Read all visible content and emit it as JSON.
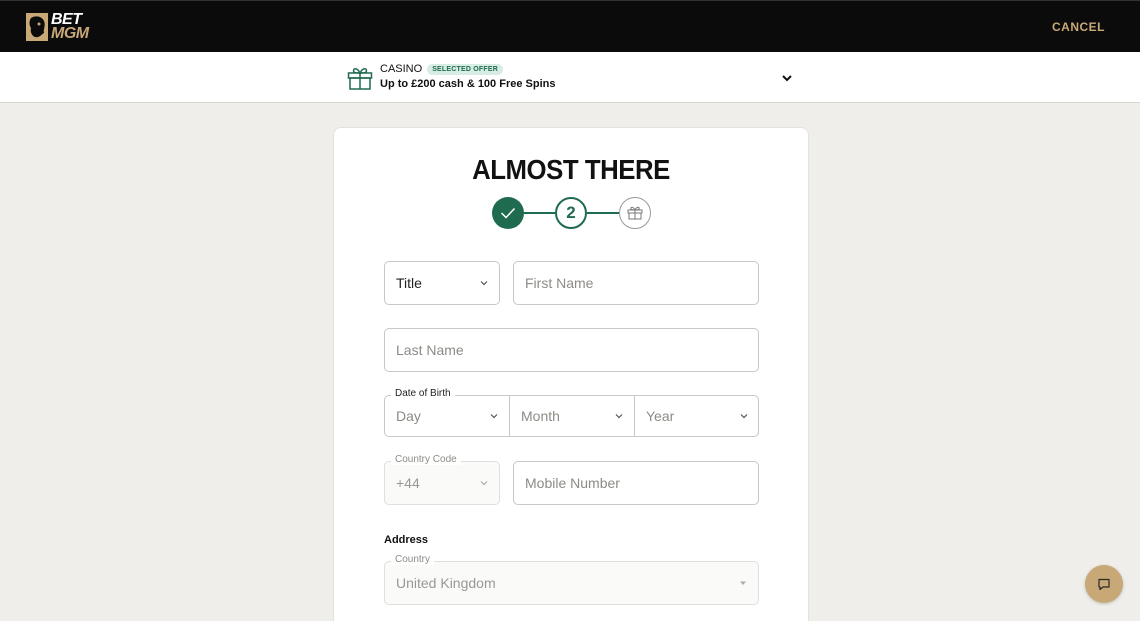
{
  "header": {
    "logo_top": "BET",
    "logo_bottom": "MGM",
    "cancel_label": "CANCEL"
  },
  "offer": {
    "category": "CASINO",
    "badge": "SELECTED OFFER",
    "title": "Up to £200 cash & 100 Free Spins"
  },
  "form": {
    "heading": "ALMOST THERE",
    "current_step": "2",
    "title_value": "Title",
    "first_name_placeholder": "First Name",
    "last_name_placeholder": "Last Name",
    "dob_label": "Date of Birth",
    "day_placeholder": "Day",
    "month_placeholder": "Month",
    "year_placeholder": "Year",
    "country_code_label": "Country Code",
    "country_code_value": "+44",
    "mobile_placeholder": "Mobile Number",
    "address_label": "Address",
    "country_label": "Country",
    "country_value": "United Kingdom"
  },
  "colors": {
    "accent_green": "#1f6b4f",
    "gold": "#c9a877"
  }
}
